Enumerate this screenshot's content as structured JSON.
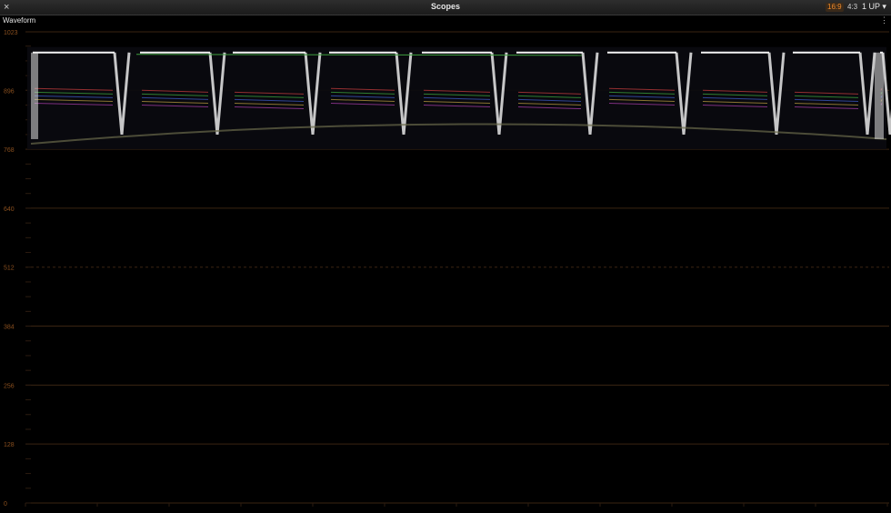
{
  "window": {
    "title": "Scopes",
    "close_icon": "×",
    "aspect_16_9": "16:9",
    "aspect_4_3": "4:3",
    "layout": "1 UP",
    "active_color": "#f08a2a"
  },
  "scope": {
    "name": "Waveform",
    "menu_icon": "⋮",
    "y_axis": {
      "range": [
        0,
        1023
      ],
      "labels": [
        "1023",
        "896",
        "768",
        "640",
        "512",
        "384",
        "256",
        "128",
        "0"
      ],
      "values": [
        1023,
        896,
        768,
        640,
        512,
        384,
        256,
        128,
        0
      ],
      "dashed_value": 512,
      "label_color": "#8a4f1e",
      "grid_color": "#3a2412"
    },
    "trace_band": [
      768,
      990
    ]
  }
}
